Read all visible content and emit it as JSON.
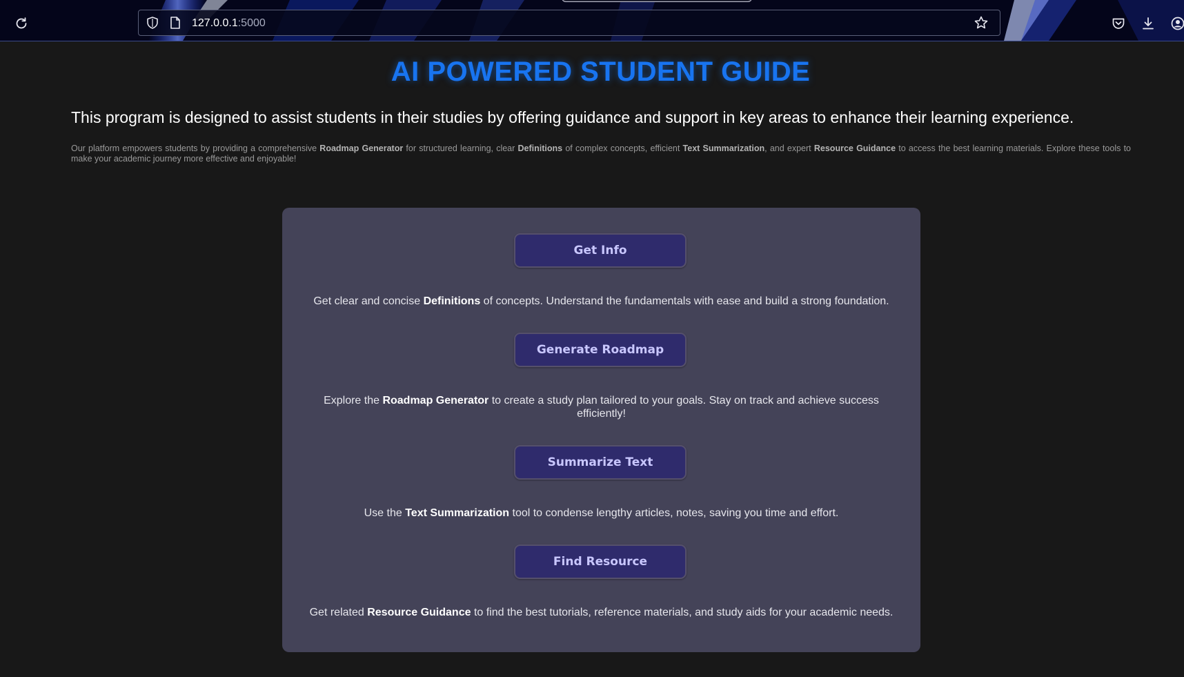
{
  "browser": {
    "url_host": "127.0.0.1",
    "url_port": ":5000",
    "icons": {
      "reload": "reload-icon",
      "shield": "shield-icon",
      "page": "page-icon",
      "bookmark": "star-icon",
      "pocket": "pocket-icon",
      "downloads": "download-icon",
      "account": "account-icon"
    }
  },
  "page": {
    "title": "AI POWERED STUDENT GUIDE",
    "intro": "This program is designed to assist students in their studies by offering guidance and support in key areas to enhance their learning experience.",
    "description": {
      "p1": "Our platform empowers students by providing a comprehensive ",
      "b1": "Roadmap Generator",
      "p2": " for structured learning, clear ",
      "b2": "Definitions",
      "p3": " of complex concepts, efficient ",
      "b3": "Text Summarization",
      "p4": ", and expert ",
      "b4": "Resource Guidance",
      "p5": " to access the best learning materials. Explore these tools to make your academic journey more effective and enjoyable!"
    }
  },
  "features": [
    {
      "button": "Get Info",
      "pre": "Get clear and concise ",
      "bold": "Definitions",
      "post": " of concepts. Understand the fundamentals with ease and build a strong foundation."
    },
    {
      "button": "Generate Roadmap",
      "pre": "Explore the ",
      "bold": "Roadmap Generator",
      "post": " to create a study plan tailored to your goals. Stay on track and achieve success efficiently!"
    },
    {
      "button": "Summarize Text",
      "pre": "Use the ",
      "bold": "Text Summarization",
      "post": " tool to condense lengthy articles, notes, saving you time and effort."
    },
    {
      "button": "Find Resource",
      "pre": "Get related ",
      "bold": "Resource Guidance",
      "post": " to find the best tutorials, reference materials, and study aids for your academic needs."
    }
  ],
  "colors": {
    "background": "#181818",
    "title": "#1874f0",
    "card": "#444358",
    "button": "#2f2b6c",
    "button_text": "#c9c7ff"
  }
}
